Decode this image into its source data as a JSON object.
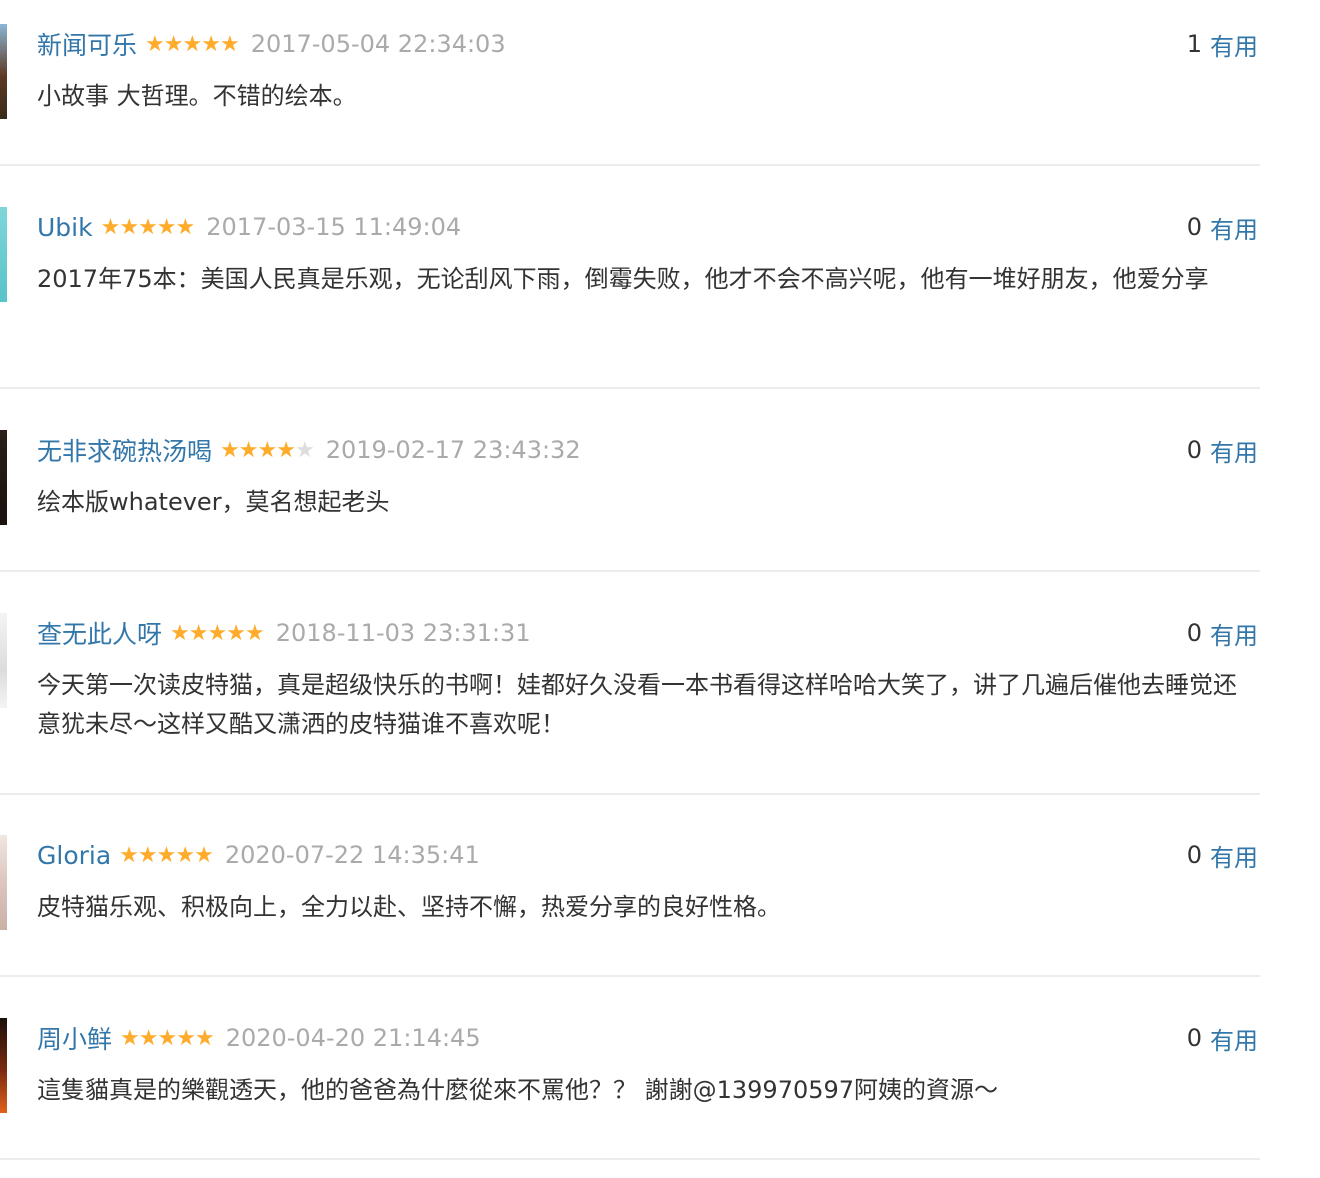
{
  "comments": [
    {
      "user": "新闻可乐",
      "rating": 5,
      "time": "2017-05-04 22:34:03",
      "votes": "1",
      "useful_label": "有用",
      "text": "小故事 大哲理。不错的绘本。"
    },
    {
      "user": "Ubik",
      "rating": 5,
      "time": "2017-03-15 11:49:04",
      "votes": "0",
      "useful_label": "有用",
      "text": "2017年75本：美国人民真是乐观，无论刮风下雨，倒霉失败，他才不会不高兴呢，他有一堆好朋友，他爱分享"
    },
    {
      "user": "无非求碗热汤喝",
      "rating": 4,
      "time": "2019-02-17 23:43:32",
      "votes": "0",
      "useful_label": "有用",
      "text": "绘本版whatever，莫名想起老头"
    },
    {
      "user": "查无此人呀",
      "rating": 5,
      "time": "2018-11-03 23:31:31",
      "votes": "0",
      "useful_label": "有用",
      "text": "今天第一次读皮特猫，真是超级快乐的书啊！娃都好久没看一本书看得这样哈哈大笑了，讲了几遍后催他去睡觉还意犹未尽～这样又酷又潇洒的皮特猫谁不喜欢呢！"
    },
    {
      "user": "Gloria",
      "rating": 5,
      "time": "2020-07-22 14:35:41",
      "votes": "0",
      "useful_label": "有用",
      "text": "皮特猫乐观、积极向上，全力以赴、坚持不懈，热爱分享的良好性格。"
    },
    {
      "user": "周小鲜",
      "rating": 5,
      "time": "2020-04-20 21:14:45",
      "votes": "0",
      "useful_label": "有用",
      "text": "這隻貓真是的樂觀透天，他的爸爸為什麼從來不罵他？？ 謝謝@139970597阿姨的資源～"
    }
  ],
  "colors": {
    "star_filled": "#ffac2d",
    "star_empty": "#dddddd",
    "link": "#3377aa",
    "meta": "#aaaaaa",
    "text": "#333333"
  }
}
